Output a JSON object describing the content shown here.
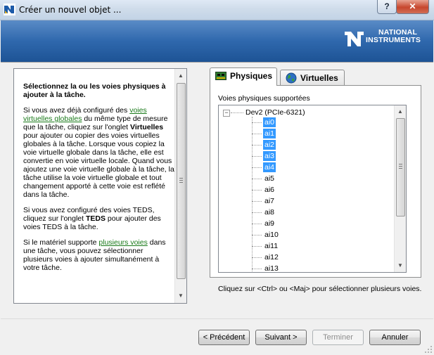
{
  "window": {
    "title": "Créer un nouvel objet ...",
    "help_label": "?",
    "close_label": "✕"
  },
  "banner": {
    "brand_line1": "NATIONAL",
    "brand_line2": "INSTRUMENTS"
  },
  "help": {
    "heading": "Sélectionnez la ou les voies physiques à ajouter à la tâche.",
    "p1_a": "Si vous avez déjà configuré des ",
    "p1_link": "voies virtuelles globales",
    "p1_b": " du même type de mesure que la tâche, cliquez sur l'onglet ",
    "p1_bold": "Virtuelles",
    "p1_c": " pour ajouter ou copier des voies virtuelles globales à la tâche. Lorsque vous copiez la voie virtuelle globale dans la tâche, elle est convertie en voie virtuelle locale. Quand vous ajoutez une voie virtuelle globale à la tâche, la tâche utilise la voie virtuelle globale et tout changement apporté à cette voie est reflété dans la tâche.",
    "p2_a": "Si vous avez configuré des voies TEDS, cliquez sur l'onglet ",
    "p2_bold": "TEDS",
    "p2_b": " pour ajouter des voies TEDS à la tâche.",
    "p3_a": "Si le matériel supporte ",
    "p3_link": "plusieurs voies",
    "p3_b": " dans une tâche, vous pouvez sélectionner plusieurs voies à ajouter simultanément à votre tâche."
  },
  "tabs": [
    {
      "label": "Physiques",
      "active": true,
      "icon": "hardware-board-icon"
    },
    {
      "label": "Virtuelles",
      "active": false,
      "icon": "globe-icon"
    }
  ],
  "channels": {
    "caption": "Voies physiques supportées",
    "device": "Dev2  (PCIe-6321)",
    "items": [
      {
        "label": "ai0",
        "selected": true
      },
      {
        "label": "ai1",
        "selected": true
      },
      {
        "label": "ai2",
        "selected": true
      },
      {
        "label": "ai3",
        "selected": true
      },
      {
        "label": "ai4",
        "selected": true
      },
      {
        "label": "ai5",
        "selected": false
      },
      {
        "label": "ai6",
        "selected": false
      },
      {
        "label": "ai7",
        "selected": false
      },
      {
        "label": "ai8",
        "selected": false
      },
      {
        "label": "ai9",
        "selected": false
      },
      {
        "label": "ai10",
        "selected": false
      },
      {
        "label": "ai11",
        "selected": false
      },
      {
        "label": "ai12",
        "selected": false
      },
      {
        "label": "ai13",
        "selected": false
      }
    ],
    "hint": "Cliquez sur <Ctrl> ou <Maj> pour sélectionner plusieurs voies."
  },
  "buttons": {
    "previous": "< Précédent",
    "next": "Suivant >",
    "finish": "Terminer",
    "cancel": "Annuler"
  },
  "colors": {
    "selection": "#3399ff",
    "banner": "#2f68ad",
    "link": "#1a7a1a"
  }
}
